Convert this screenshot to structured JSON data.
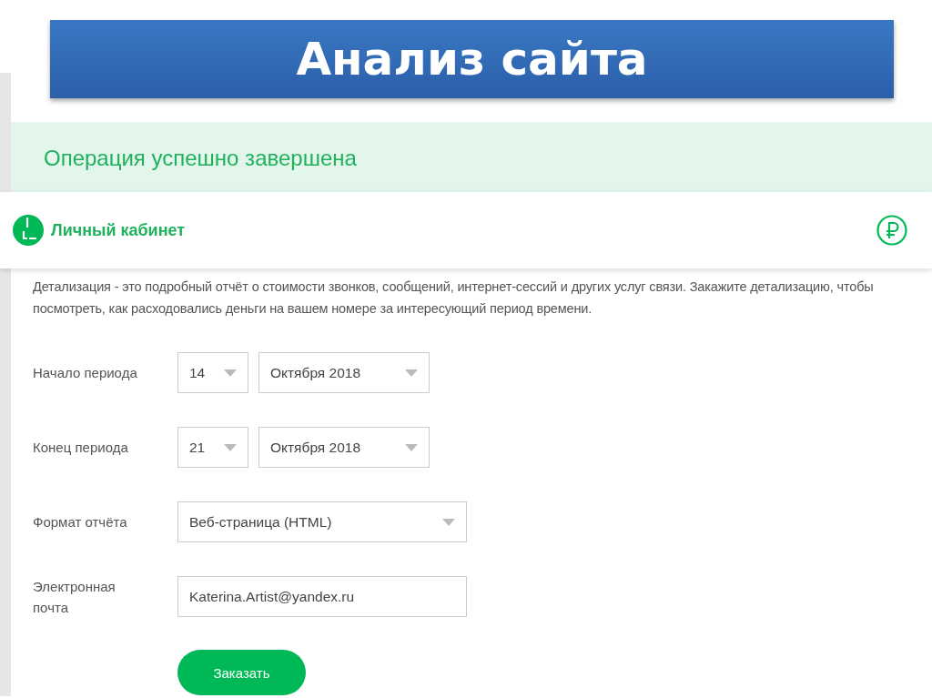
{
  "slide_title": "Анализ сайта",
  "success_message": "Операция успешно завершена",
  "header": {
    "brand": "Личный кабинет"
  },
  "description": "Детализация - это подробный отчёт о стоимости звонков, сообщений, интернет-сессий и других услуг связи. Закажите детализацию, чтобы посмотреть, как расходовались деньги на вашем номере за интересующий период времени.",
  "form_rows": [
    {
      "label": "Начало периода",
      "kind": "date",
      "day": "14",
      "month": "Октября 2018"
    },
    {
      "label": "Конец периода",
      "kind": "date",
      "day": "21",
      "month": "Октября 2018"
    },
    {
      "label": "Формат отчёта",
      "kind": "select",
      "value": "Веб-страница (HTML)"
    },
    {
      "label": "Электронная почта",
      "kind": "input",
      "value": "Katerina.Artist@yandex.ru"
    }
  ],
  "submit_button": "Заказать"
}
